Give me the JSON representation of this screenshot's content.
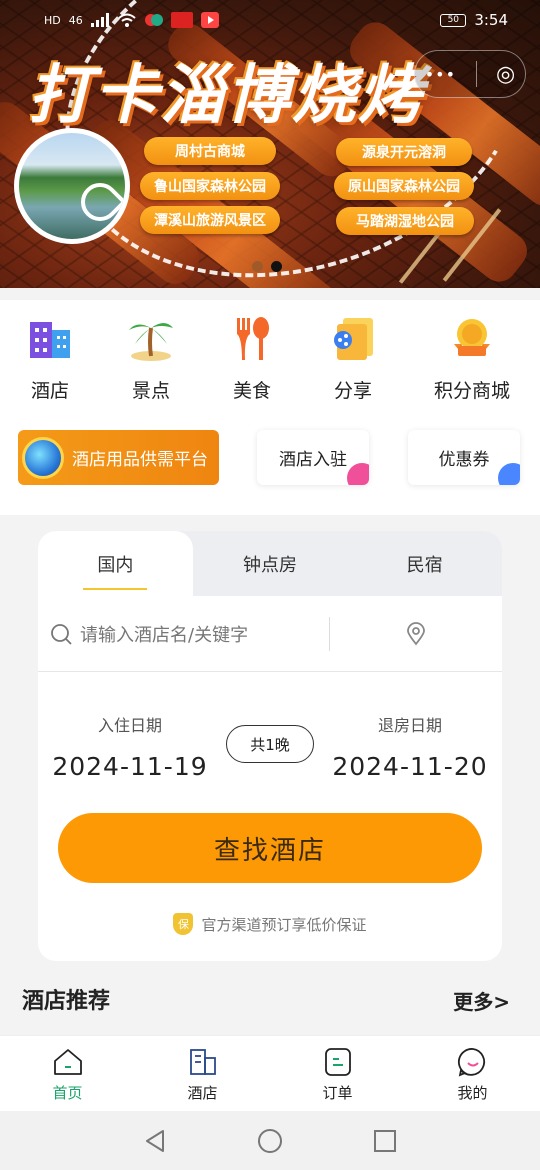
{
  "status_bar": {
    "left_labels": [
      "HD",
      "46"
    ],
    "battery": "50",
    "time": "3:54"
  },
  "banner": {
    "title": "打卡淄博烧烤",
    "tags_left": [
      "周村古商城",
      "鲁山国家森林公园",
      "潭溪山旅游风景区"
    ],
    "tags_right": [
      "源泉开元溶洞",
      "原山国家森林公园",
      "马踏湖湿地公园"
    ],
    "capsule_more": "•••",
    "capsule_close": "◎",
    "carousel": {
      "count": 2,
      "active_index": 1
    }
  },
  "categories": [
    {
      "label": "酒店",
      "icon": "hotel-building-icon"
    },
    {
      "label": "景点",
      "icon": "palm-tree-icon"
    },
    {
      "label": "美食",
      "icon": "fork-spoon-icon"
    },
    {
      "label": "分享",
      "icon": "share-folder-icon"
    },
    {
      "label": "积分商城",
      "icon": "points-medal-icon"
    }
  ],
  "quick_links": {
    "promo": "酒店用品供需平台",
    "hotel_join": "酒店入驻",
    "coupon": "优惠券"
  },
  "search_card": {
    "tabs": [
      "国内",
      "钟点房",
      "民宿"
    ],
    "active_tab": 0,
    "search_placeholder": "请输入酒店名/关键字",
    "checkin_label": "入住日期",
    "checkin_value": "2024-11-19",
    "checkout_label": "退房日期",
    "checkout_value": "2024-11-20",
    "nights": "共1晚",
    "find_button": "查找酒店",
    "guarantee_badge": "保",
    "guarantee_text": "官方渠道预订享低价保证"
  },
  "recommend": {
    "title": "酒店推荐",
    "more": "更多>"
  },
  "tab_bar": [
    {
      "label": "首页",
      "icon": "home-icon",
      "active": true
    },
    {
      "label": "酒店",
      "icon": "hotel-icon",
      "active": false
    },
    {
      "label": "订单",
      "icon": "order-icon",
      "active": false
    },
    {
      "label": "我的",
      "icon": "profile-icon",
      "active": false
    }
  ],
  "colors": {
    "accent_orange": "#fc9905",
    "active_green": "#1aa36a",
    "tag_orange": "#f29112"
  }
}
